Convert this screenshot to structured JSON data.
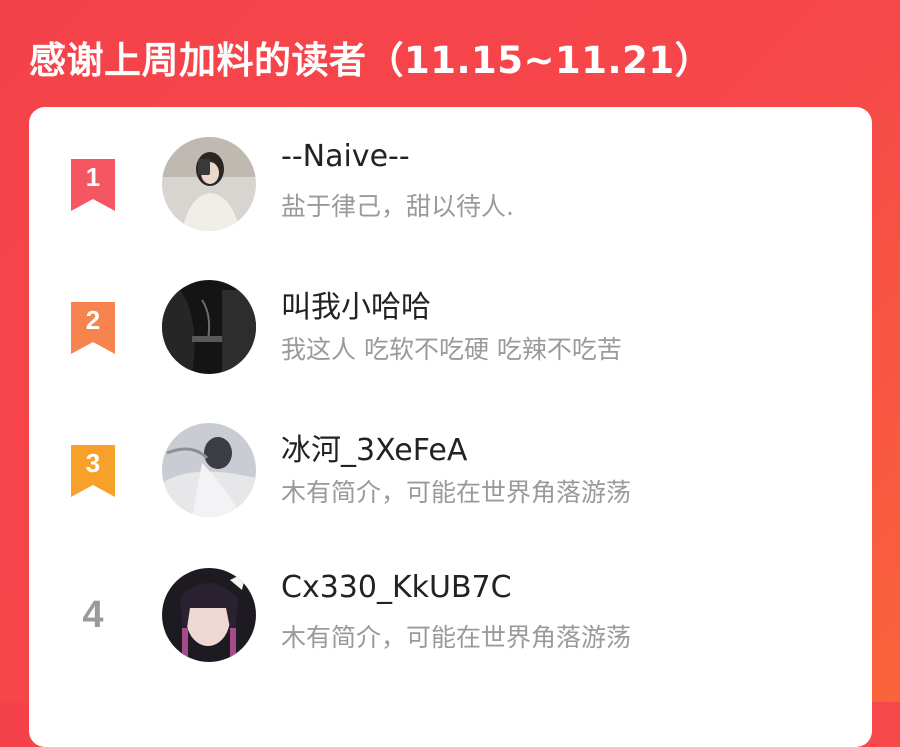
{
  "header": {
    "title": "感谢上周加料的读者（11.15~11.21）"
  },
  "colors": {
    "background": "#f5424a",
    "rank1": "#f45761",
    "rank2": "#f7844f",
    "rank3": "#f8a12a",
    "rank_plain": "#9a9a9a"
  },
  "readers": [
    {
      "rank": "1",
      "name": "--Naive--",
      "bio": "盐于律己，甜以待人.",
      "avatar_icon": "avatar-photo-icon"
    },
    {
      "rank": "2",
      "name": "叫我小哈哈",
      "bio": "我这人 吃软不吃硬 吃辣不吃苦",
      "avatar_icon": "avatar-photo-icon"
    },
    {
      "rank": "3",
      "name": "冰河_3XeFeA",
      "bio": "木有简介，可能在世界角落游荡",
      "avatar_icon": "avatar-photo-icon"
    },
    {
      "rank": "4",
      "name": "Cx330_KkUB7C",
      "bio": "木有简介，可能在世界角落游荡",
      "avatar_icon": "avatar-photo-icon"
    }
  ]
}
